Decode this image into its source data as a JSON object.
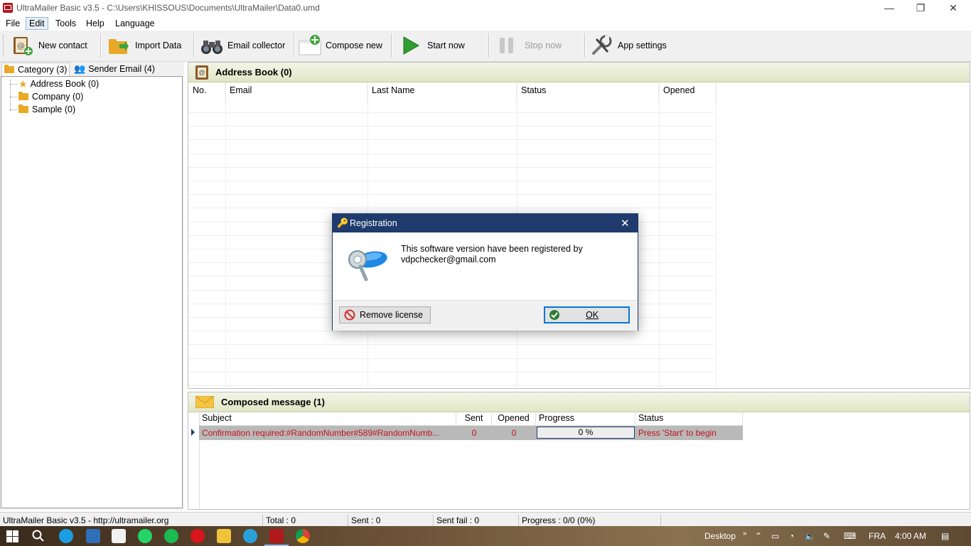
{
  "window": {
    "title": "UltraMailer Basic v3.5 - C:\\Users\\KHISSOUS\\Documents\\UltraMailer\\Data0.umd",
    "minimize_glyph": "—",
    "maximize_glyph": "❐",
    "close_glyph": "✕"
  },
  "menu": [
    "File",
    "Edit",
    "Tools",
    "Help",
    "Language"
  ],
  "toolbar": {
    "new_contact": "New contact",
    "import_data": "Import Data",
    "email_collector": "Email collector",
    "compose_new": "Compose new",
    "start_now": "Start now",
    "stop_now": "Stop now",
    "app_settings": "App settings"
  },
  "left_tabs": {
    "category": "Category (3)",
    "sender_email": "Sender Email (4)"
  },
  "tree": [
    "Address Book (0)",
    "Company (0)",
    "Sample (0)"
  ],
  "address_book": {
    "title": "Address Book (0)",
    "columns": [
      "No.",
      "Email",
      "Last Name",
      "Status",
      "Opened"
    ]
  },
  "composed": {
    "title": "Composed message (1)",
    "columns": [
      "Subject",
      "Sent",
      "Opened",
      "Progress",
      "Status"
    ],
    "rows": [
      {
        "subject": "Confirmation required:#RandomNumber#589#RandomNumb...",
        "sent": "0",
        "opened": "0",
        "progress": "0 %",
        "status": "Press 'Start' to begin"
      }
    ]
  },
  "statusbar": {
    "app": "UltraMailer Basic v3.5 - http://ultramailer.org",
    "total": "Total : 0",
    "sent": "Sent : 0",
    "sent_fail": "Sent fail : 0",
    "progress": "Progress : 0/0 (0%)"
  },
  "dialog": {
    "title": "Registration",
    "message_line1": "This software version have been registered by",
    "message_line2": "vdpchecker@gmail.com",
    "remove_license": "Remove license",
    "ok": "OK",
    "close_glyph": "✕"
  },
  "taskbar": {
    "desktop": "Desktop",
    "lang": "FRA",
    "time": "4:00 AM"
  },
  "colors": {
    "accent": "#1f3b6e",
    "row_text": "#c0141c",
    "panel_header": "#e1e6c6"
  }
}
